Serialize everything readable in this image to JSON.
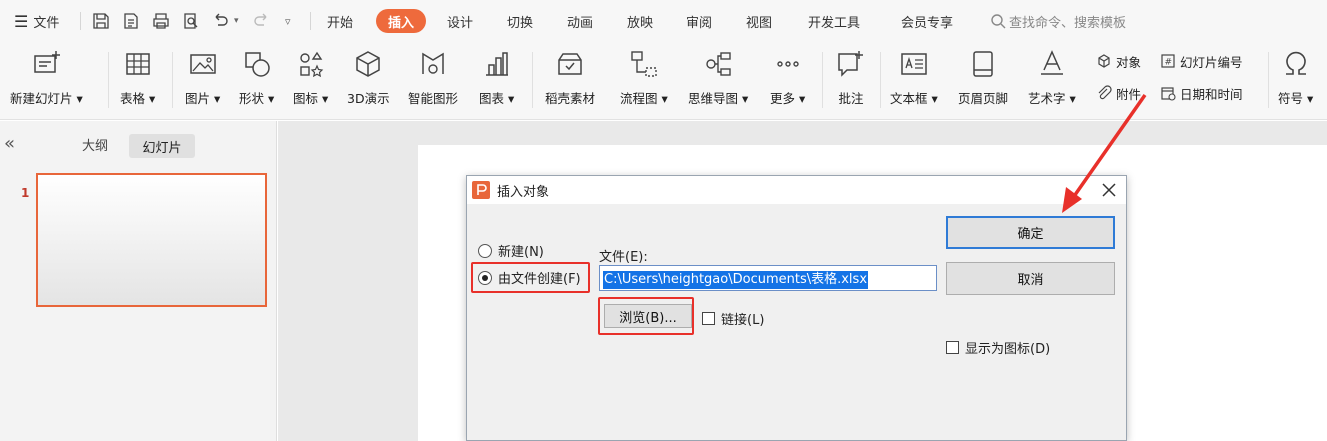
{
  "menubar": {
    "file_menu": "文件",
    "tabs": [
      "开始",
      "插入",
      "设计",
      "切换",
      "动画",
      "放映",
      "审阅",
      "视图",
      "开发工具",
      "会员专享"
    ],
    "active_tab": "插入",
    "search_placeholder": "查找命令、搜索模板"
  },
  "ribbon": {
    "new_slide": "新建幻灯片",
    "table": "表格",
    "picture": "图片",
    "shape": "形状",
    "icon": "图标",
    "demo3d": "3D演示",
    "smart_graphic": "智能图形",
    "chart": "图表",
    "docer": "稻壳素材",
    "flowchart": "流程图",
    "mindmap": "思维导图",
    "more": "更多",
    "comment": "批注",
    "textbox": "文本框",
    "header_footer": "页眉页脚",
    "wordart": "艺术字",
    "object": "对象",
    "attachment": "附件",
    "slide_number": "幻灯片编号",
    "datetime": "日期和时间",
    "symbol": "符号"
  },
  "left_panel": {
    "outline_tab": "大纲",
    "slides_tab": "幻灯片",
    "slide_number": "1"
  },
  "dialog": {
    "title": "插入对象",
    "radio_new": "新建(N)",
    "radio_from_file": "由文件创建(F)",
    "file_label": "文件(E):",
    "file_path": "C:\\Users\\heightgao\\Documents\\表格.xlsx",
    "browse_button": "浏览(B)...",
    "link_checkbox": "链接(L)",
    "ok_button": "确定",
    "cancel_button": "取消",
    "display_as_icon": "显示为图标(D)"
  },
  "colors": {
    "accent": "#ee6a3c",
    "highlight": "#e8302a",
    "selection": "#1473e6"
  }
}
